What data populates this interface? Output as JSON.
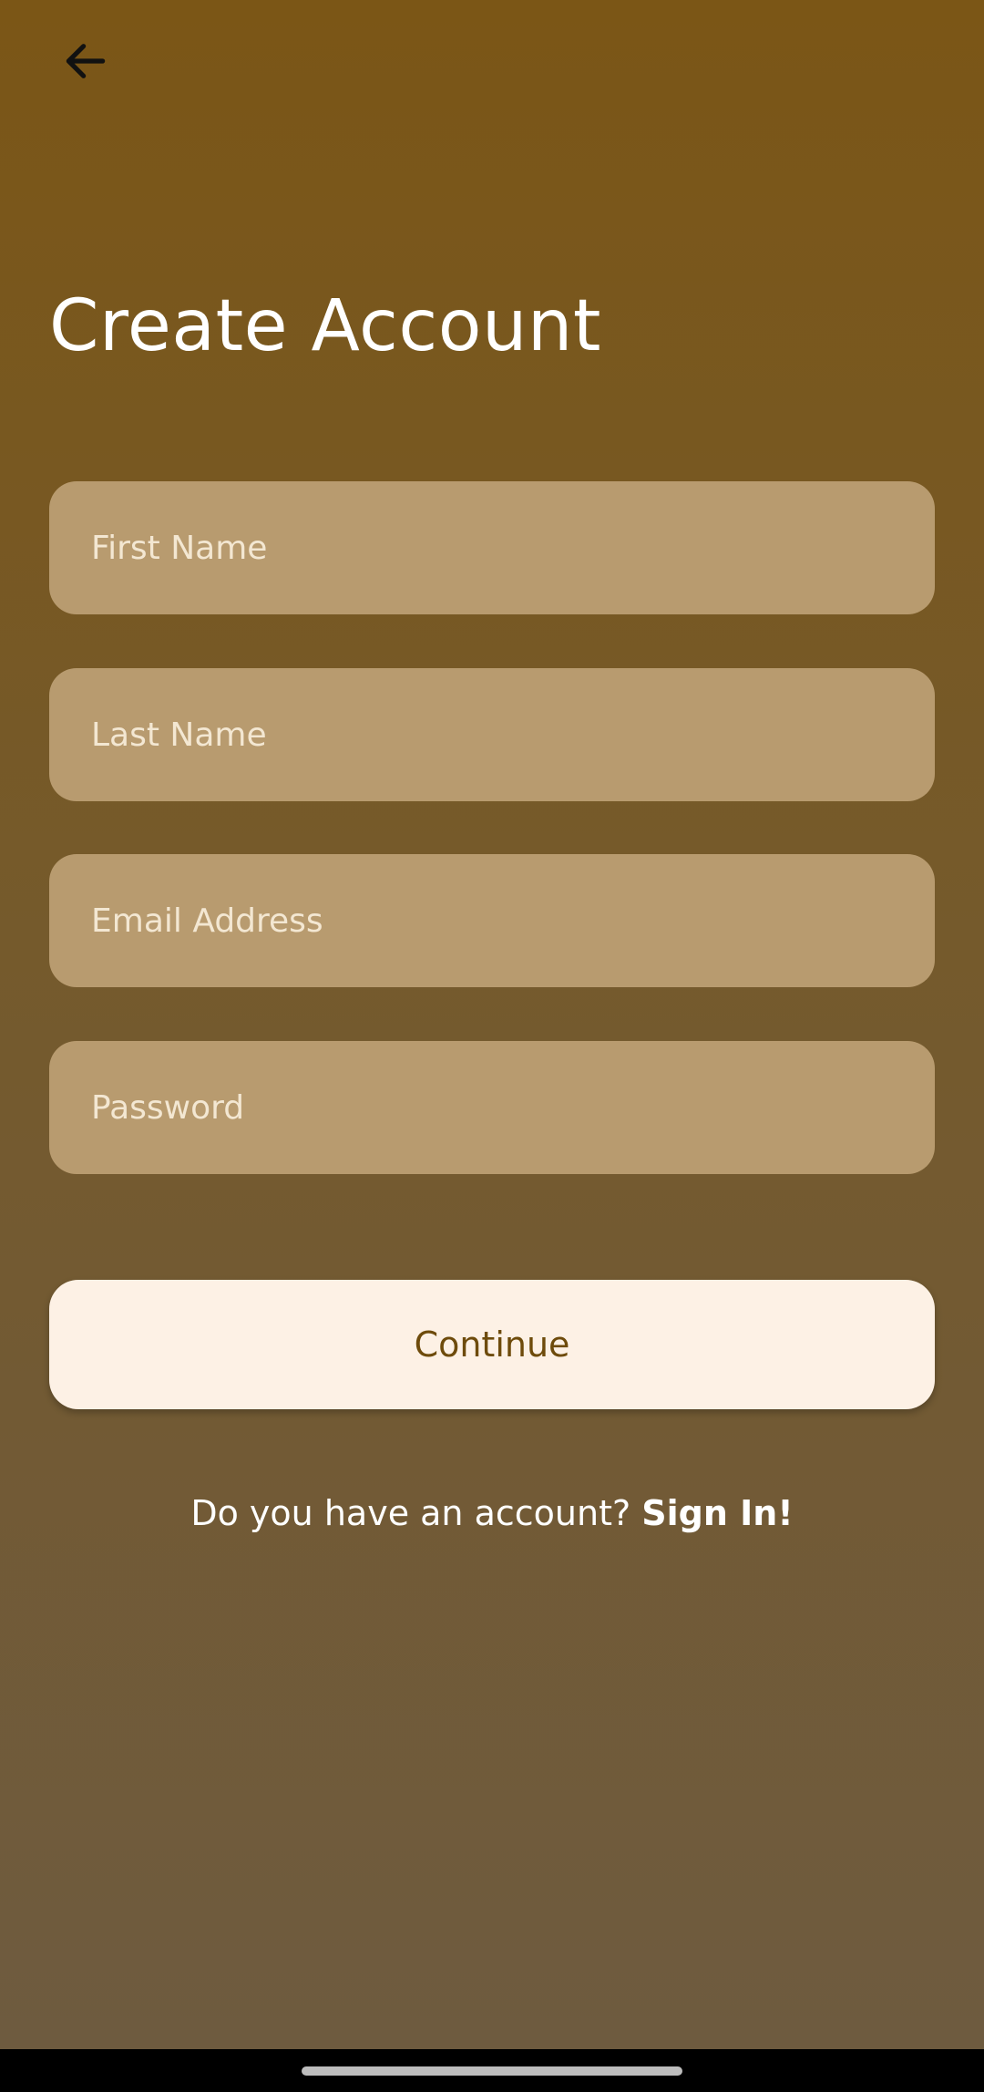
{
  "header": {
    "back_icon": "arrow-left-icon",
    "title": "Create Account"
  },
  "form": {
    "first_name": {
      "placeholder": "First Name",
      "value": ""
    },
    "last_name": {
      "placeholder": "Last Name",
      "value": ""
    },
    "email": {
      "placeholder": "Email Address",
      "value": ""
    },
    "password": {
      "placeholder": "Password",
      "value": ""
    },
    "continue_label": "Continue"
  },
  "footer": {
    "prompt": "Do you have an account?",
    "signin_label": "Sign In!"
  },
  "colors": {
    "background_top": "#7b5616",
    "background_bottom": "#6e5b40",
    "field_fill": "#b89b6f",
    "button_fill": "#fdf1e5",
    "button_text": "#6e4b0b"
  }
}
